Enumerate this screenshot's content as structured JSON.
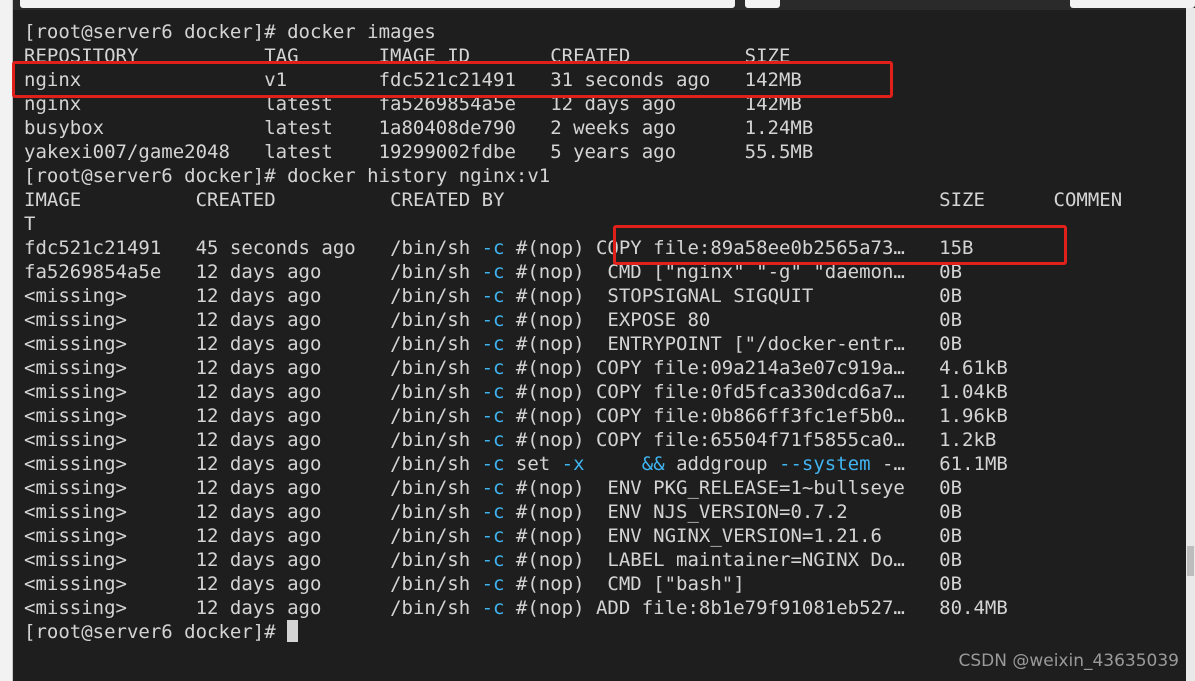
{
  "prompt": "[root@server6 docker]# ",
  "commands": {
    "images": "docker images",
    "history": "docker history nginx:v1"
  },
  "images": {
    "headers": [
      "REPOSITORY",
      "TAG",
      "IMAGE ID",
      "CREATED",
      "SIZE"
    ],
    "rows": [
      [
        "nginx",
        "v1",
        "fdc521c21491",
        "31 seconds ago",
        "142MB"
      ],
      [
        "nginx",
        "latest",
        "fa5269854a5e",
        "12 days ago",
        "142MB"
      ],
      [
        "busybox",
        "latest",
        "1a80408de790",
        "2 weeks ago",
        "1.24MB"
      ],
      [
        "yakexi007/game2048",
        "latest",
        "19299002fdbe",
        "5 years ago",
        "55.5MB"
      ]
    ]
  },
  "history": {
    "headers": [
      "IMAGE",
      "CREATED",
      "CREATED BY",
      "SIZE",
      "COMMEN"
    ],
    "header_wrap": "T",
    "rows": [
      {
        "image": "fdc521c21491",
        "created": "45 seconds ago",
        "sh": "/bin/sh ",
        "flag": "-c",
        "rest": " #(nop) COPY file:89a58ee0b2565a73…",
        "size": "15B"
      },
      {
        "image": "fa5269854a5e",
        "created": "12 days ago",
        "sh": "/bin/sh ",
        "flag": "-c",
        "rest": " #(nop)  CMD [\"nginx\" \"-g\" \"daemon…",
        "size": "0B"
      },
      {
        "image": "<missing>",
        "created": "12 days ago",
        "sh": "/bin/sh ",
        "flag": "-c",
        "rest": " #(nop)  STOPSIGNAL SIGQUIT",
        "size": "0B"
      },
      {
        "image": "<missing>",
        "created": "12 days ago",
        "sh": "/bin/sh ",
        "flag": "-c",
        "rest": " #(nop)  EXPOSE 80",
        "size": "0B"
      },
      {
        "image": "<missing>",
        "created": "12 days ago",
        "sh": "/bin/sh ",
        "flag": "-c",
        "rest": " #(nop)  ENTRYPOINT [\"/docker-entr…",
        "size": "0B"
      },
      {
        "image": "<missing>",
        "created": "12 days ago",
        "sh": "/bin/sh ",
        "flag": "-c",
        "rest": " #(nop) COPY file:09a214a3e07c919a…",
        "size": "4.61kB"
      },
      {
        "image": "<missing>",
        "created": "12 days ago",
        "sh": "/bin/sh ",
        "flag": "-c",
        "rest": " #(nop) COPY file:0fd5fca330dcd6a7…",
        "size": "1.04kB"
      },
      {
        "image": "<missing>",
        "created": "12 days ago",
        "sh": "/bin/sh ",
        "flag": "-c",
        "rest": " #(nop) COPY file:0b866ff3fc1ef5b0…",
        "size": "1.96kB"
      },
      {
        "image": "<missing>",
        "created": "12 days ago",
        "sh": "/bin/sh ",
        "flag": "-c",
        "rest": " #(nop) COPY file:65504f71f5855ca0…",
        "size": "1.2kB"
      },
      {
        "image": "<missing>",
        "created": "12 days ago",
        "sh": "/bin/sh ",
        "flag": "-c",
        "rest": " set -x",
        "rest2": "     && addgroup --system -…",
        "size": "61.1MB",
        "special": true
      },
      {
        "image": "<missing>",
        "created": "12 days ago",
        "sh": "/bin/sh ",
        "flag": "-c",
        "rest": " #(nop)  ENV PKG_RELEASE=1~bullseye",
        "size": "0B"
      },
      {
        "image": "<missing>",
        "created": "12 days ago",
        "sh": "/bin/sh ",
        "flag": "-c",
        "rest": " #(nop)  ENV NJS_VERSION=0.7.2",
        "size": "0B"
      },
      {
        "image": "<missing>",
        "created": "12 days ago",
        "sh": "/bin/sh ",
        "flag": "-c",
        "rest": " #(nop)  ENV NGINX_VERSION=1.21.6",
        "size": "0B"
      },
      {
        "image": "<missing>",
        "created": "12 days ago",
        "sh": "/bin/sh ",
        "flag": "-c",
        "rest": " #(nop)  LABEL maintainer=NGINX Do…",
        "size": "0B"
      },
      {
        "image": "<missing>",
        "created": "12 days ago",
        "sh": "/bin/sh ",
        "flag": "-c",
        "rest": " #(nop)  CMD [\"bash\"]",
        "size": "0B"
      },
      {
        "image": "<missing>",
        "created": "12 days ago",
        "sh": "/bin/sh ",
        "flag": "-c",
        "rest": " #(nop) ADD file:8b1e79f91081eb527…",
        "size": "80.4MB"
      }
    ]
  },
  "watermark": "CSDN @weixin_43635039",
  "colors": {
    "background": "#1e1e1e",
    "text": "#d4d4d4",
    "flag": "#3fb4f0",
    "highlight": "#e0201b"
  }
}
